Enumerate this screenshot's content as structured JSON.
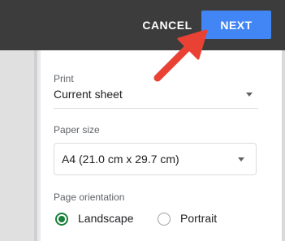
{
  "toolbar": {
    "cancel_label": "CANCEL",
    "next_label": "NEXT"
  },
  "print": {
    "label": "Print",
    "value": "Current sheet"
  },
  "paper_size": {
    "label": "Paper size",
    "value": "A4 (21.0 cm x 29.7 cm)"
  },
  "orientation": {
    "label": "Page orientation",
    "options": [
      "Landscape",
      "Portrait"
    ],
    "selected": "Landscape"
  },
  "colors": {
    "topbar": "#3c3c3c",
    "next_button": "#4285f4",
    "radio_selected": "#188038",
    "annotation_arrow": "#e94235"
  }
}
